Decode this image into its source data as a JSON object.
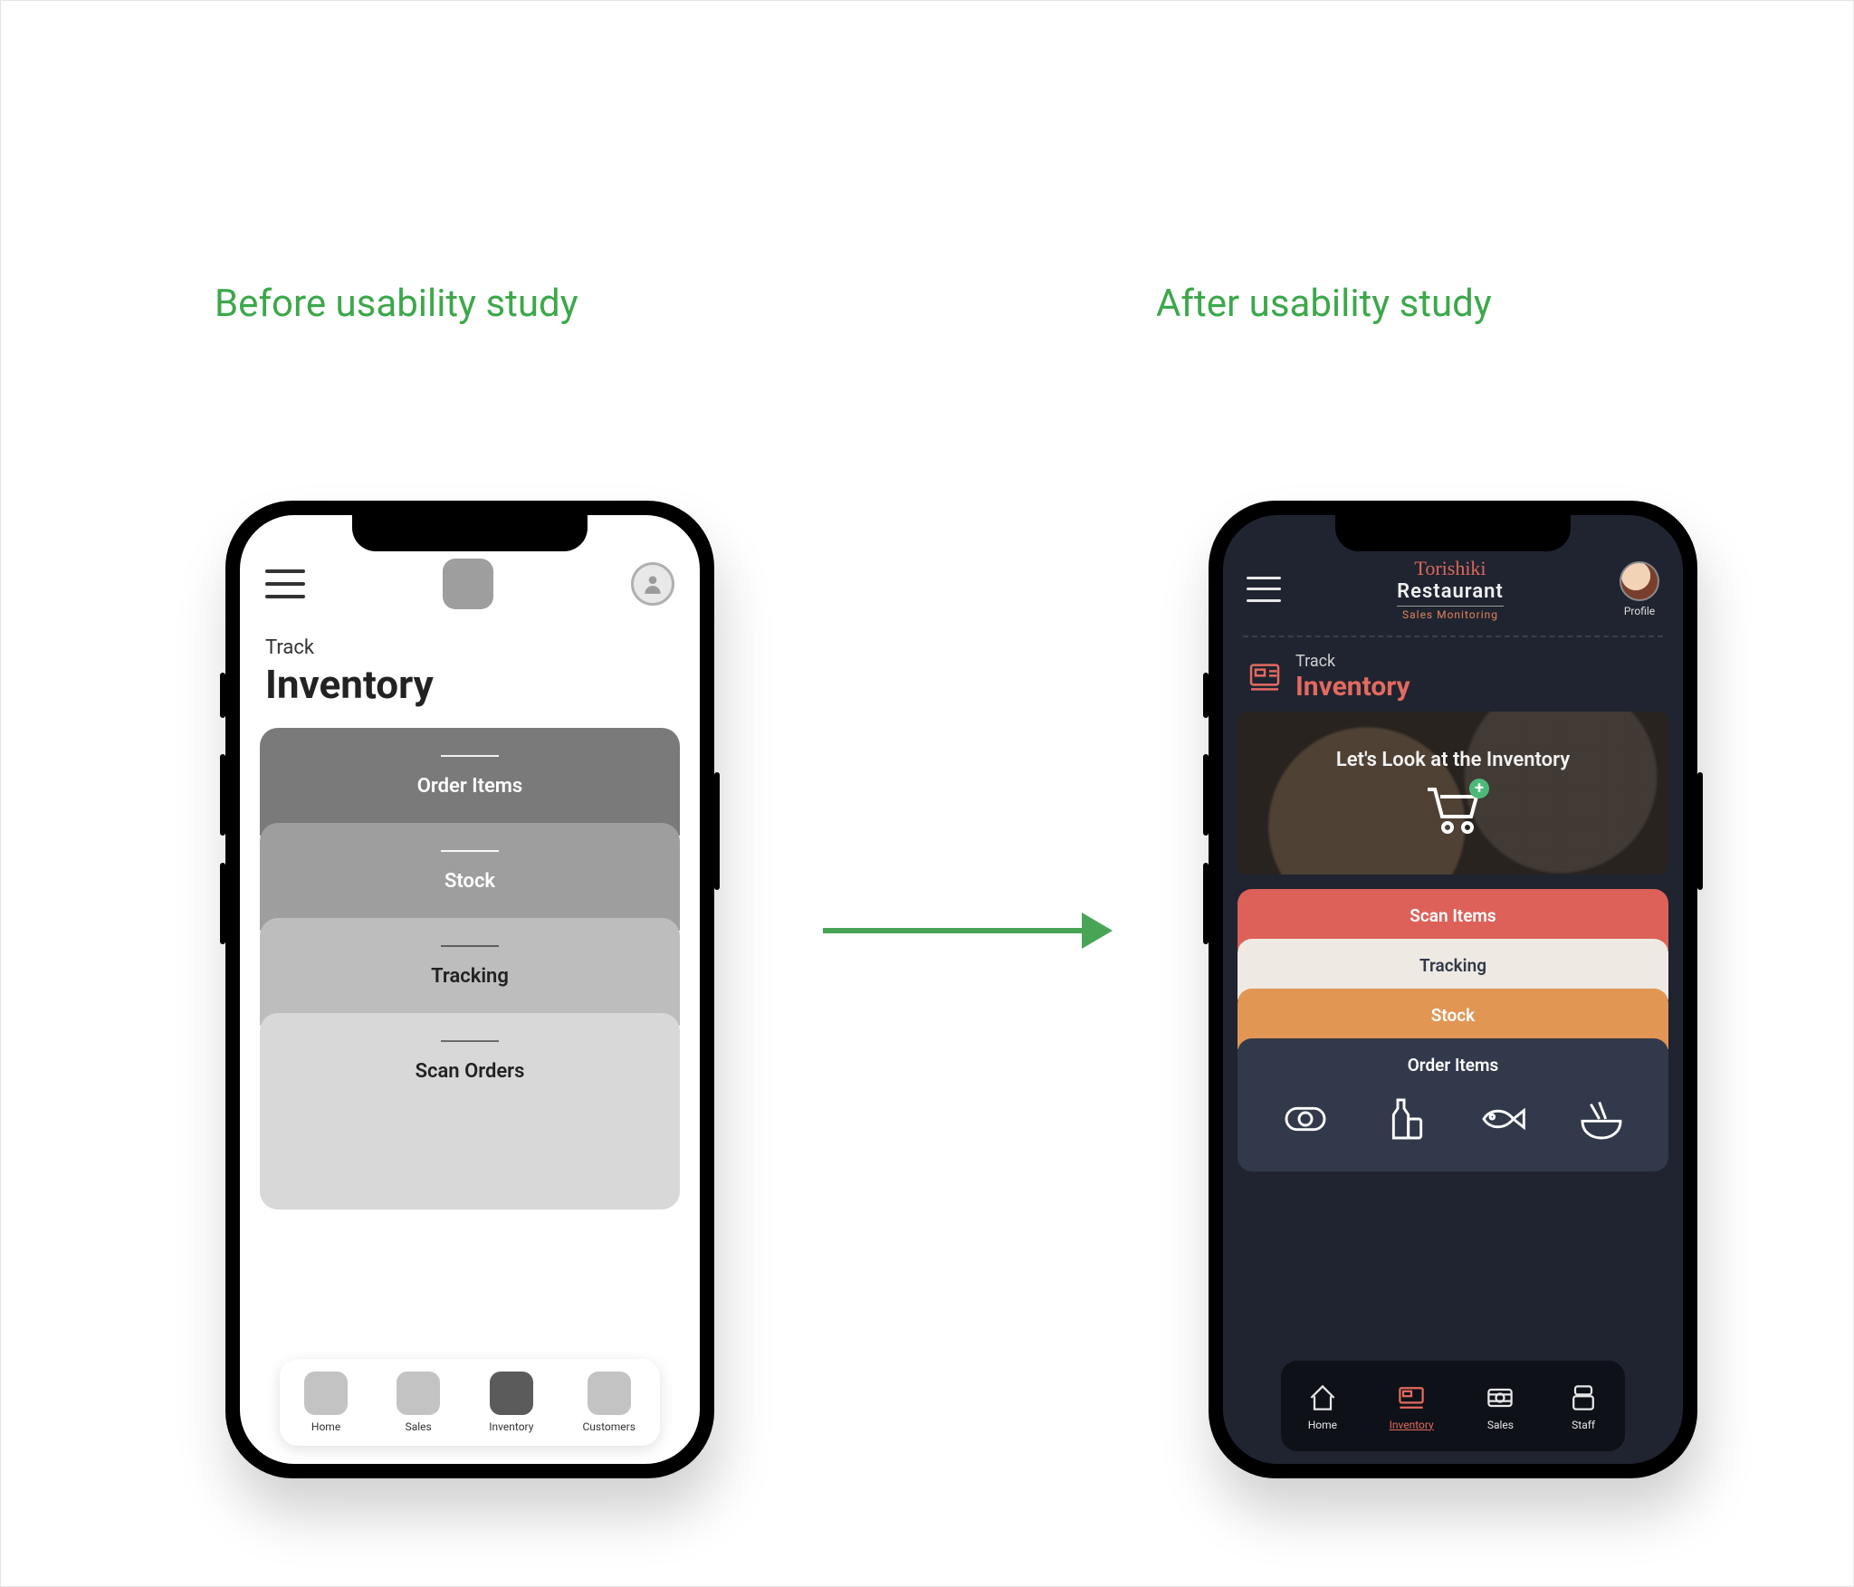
{
  "captions": {
    "before": "Before usability study",
    "after": "After usability study"
  },
  "before": {
    "title": {
      "pre": "Track",
      "main": "Inventory"
    },
    "cards": [
      "Order Items",
      "Stock",
      "Tracking",
      "Scan Orders"
    ],
    "tabs": [
      "Home",
      "Sales",
      "Inventory",
      "Customers"
    ],
    "activeTab": "Inventory"
  },
  "after": {
    "brand": {
      "script": "Torishiki",
      "name": "Restaurant",
      "subtitle": "Sales Monitoring"
    },
    "profileLabel": "Profile",
    "title": {
      "pre": "Track",
      "main": "Inventory"
    },
    "heroText": "Let's Look at the Inventory",
    "cards": [
      "Scan Items",
      "Tracking",
      "Stock",
      "Order Items"
    ],
    "orderIcons": [
      "sushi-icon",
      "bottle-icon",
      "fish-icon",
      "bowl-icon"
    ],
    "tabs": [
      "Home",
      "Inventory",
      "Sales",
      "Staff"
    ],
    "activeTab": "Inventory"
  },
  "colors": {
    "accent": "#3ca84a",
    "afterAccent": "#e46a5f",
    "afterCard1": "#dd6159",
    "afterCard2": "#eeeae3",
    "afterCard3": "#e19654",
    "afterCard4": "#32394a"
  }
}
